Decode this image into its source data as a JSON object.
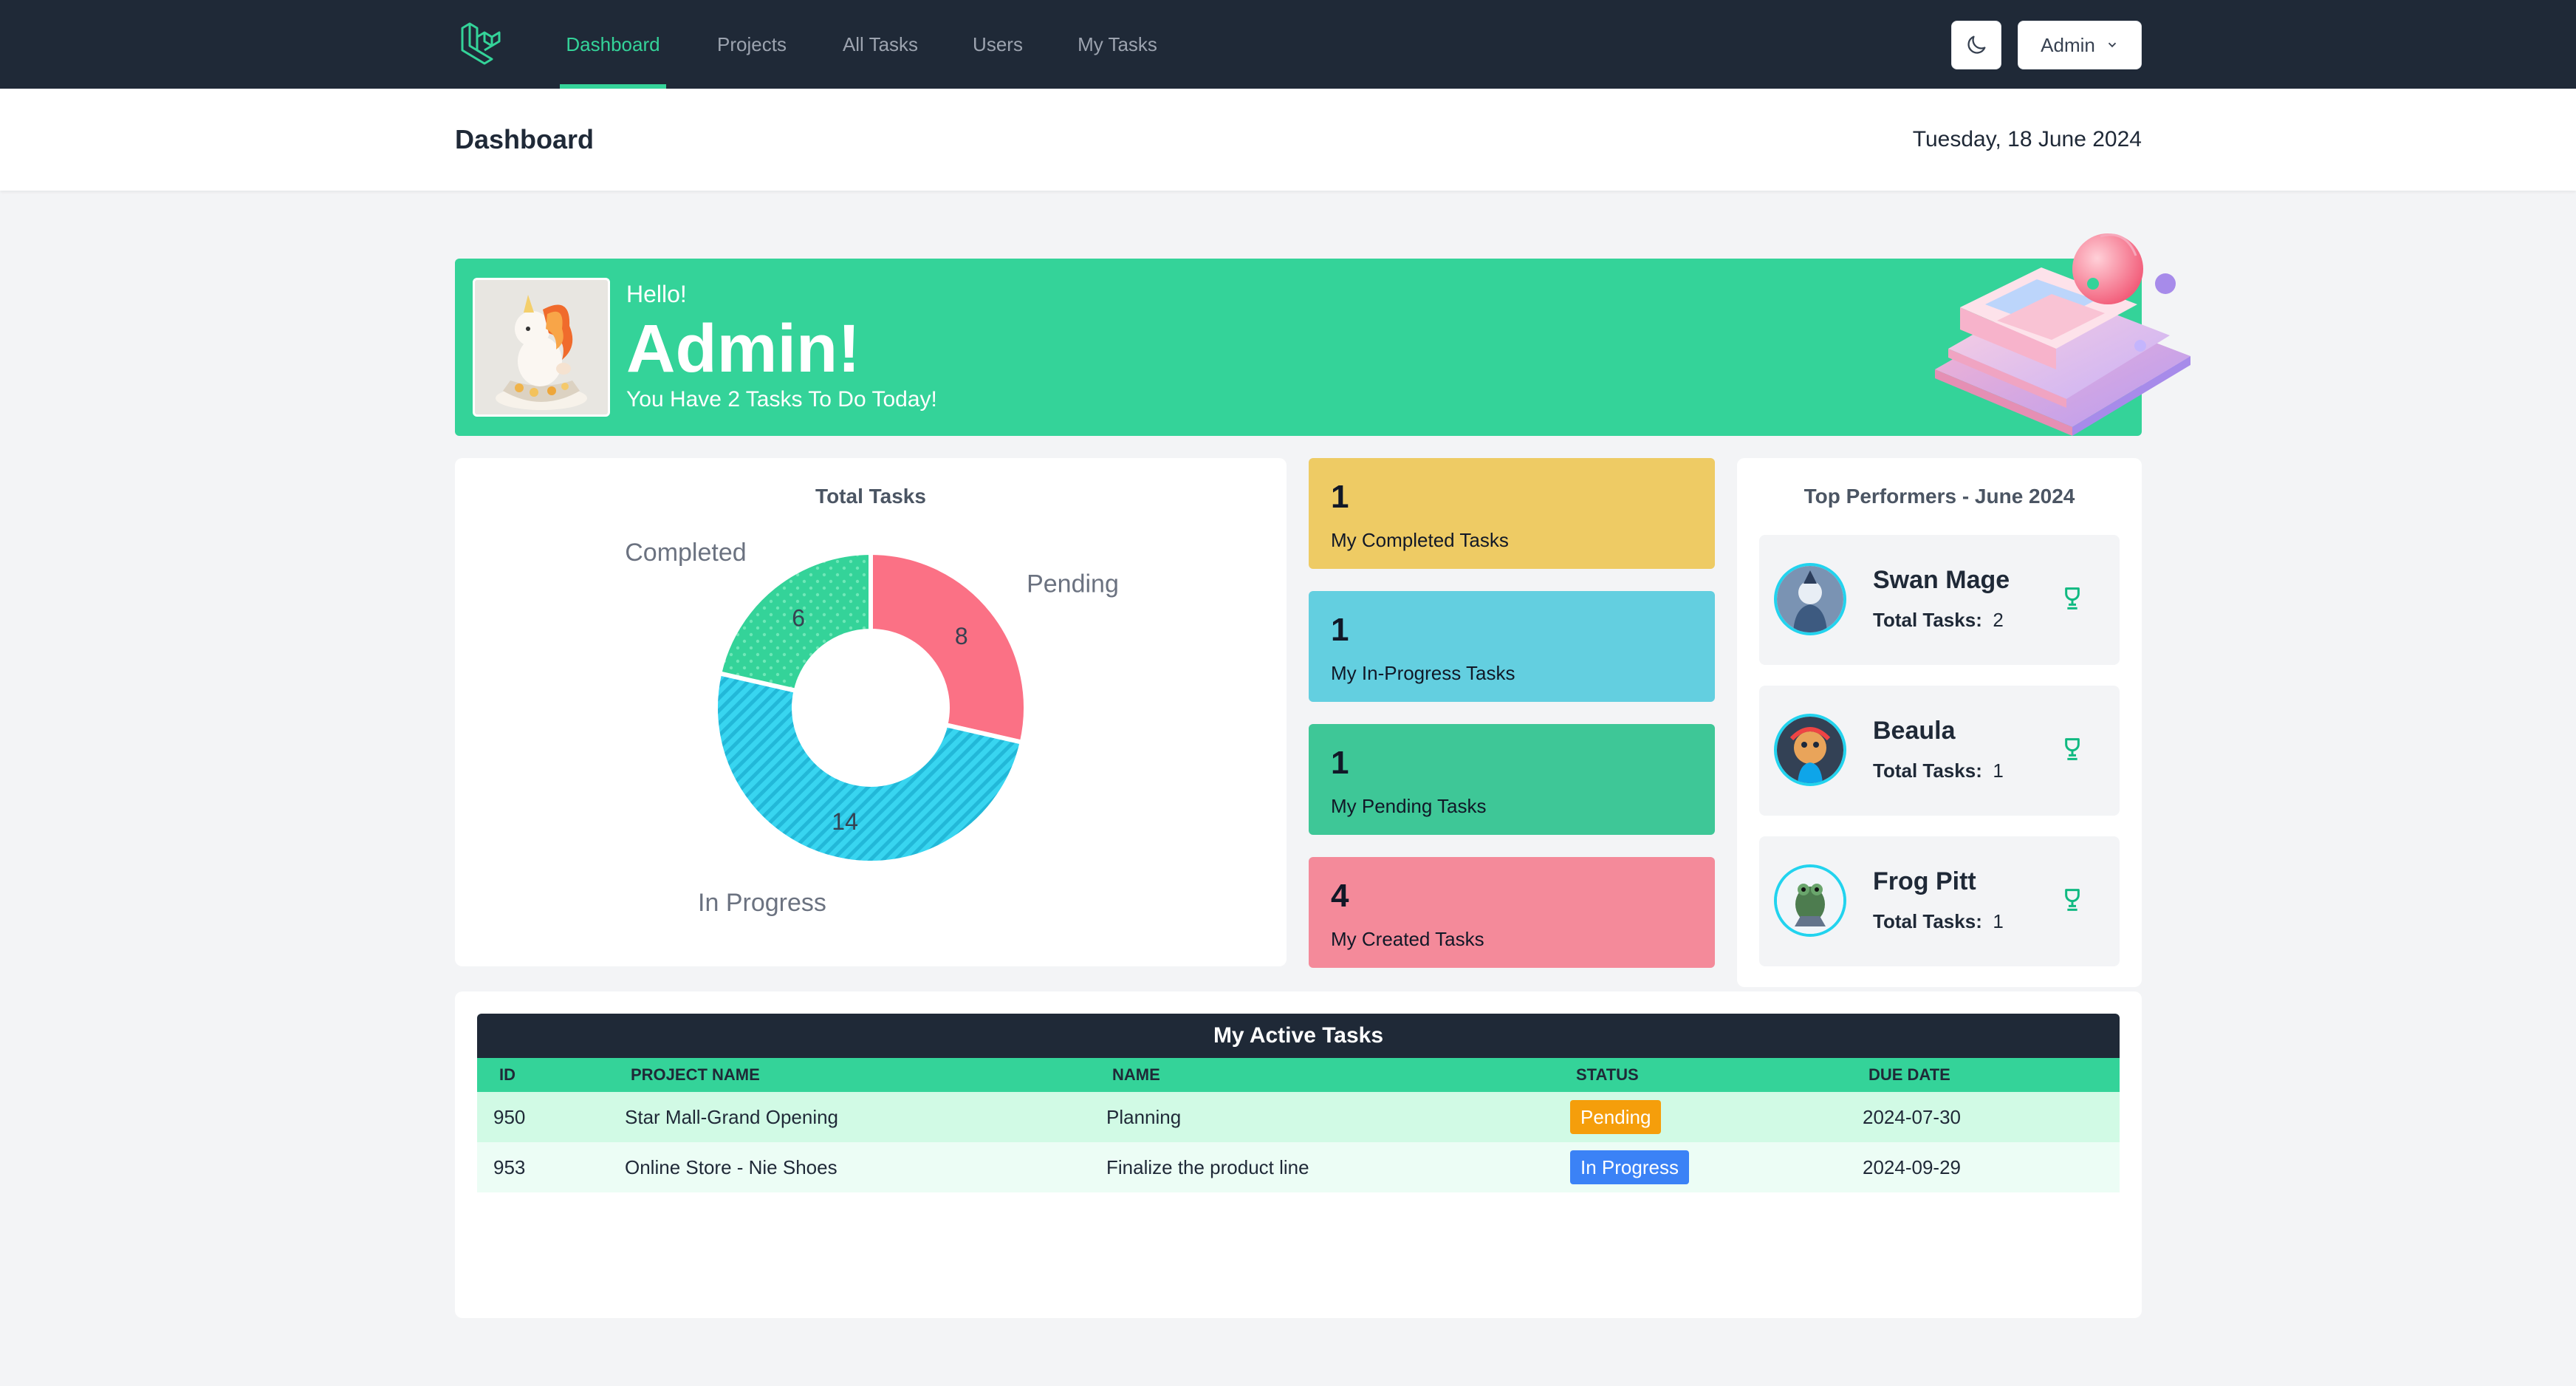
{
  "nav": {
    "items": [
      {
        "label": "Dashboard",
        "active": true
      },
      {
        "label": "Projects",
        "active": false
      },
      {
        "label": "All Tasks",
        "active": false
      },
      {
        "label": "Users",
        "active": false
      },
      {
        "label": "My Tasks",
        "active": false
      }
    ],
    "user_label": "Admin",
    "theme_icon": "moon-icon",
    "accent": "#34d399"
  },
  "header": {
    "title": "Dashboard",
    "date": "Tuesday, 18 June 2024"
  },
  "hero": {
    "hello": "Hello!",
    "name": "Admin!",
    "subtitle": "You Have 2 Tasks To Do Today!"
  },
  "chart_data": {
    "type": "pie",
    "title": "Total Tasks",
    "categories": [
      "Pending",
      "In Progress",
      "Completed"
    ],
    "values": [
      8,
      14,
      6
    ],
    "colors": [
      "#fb7185",
      "#38d5f0",
      "#34d399"
    ],
    "hole": true
  },
  "stats": [
    {
      "value": "1",
      "label": "My Completed Tasks",
      "color": "#eecb64"
    },
    {
      "value": "1",
      "label": "My In-Progress Tasks",
      "color": "#63cfe0"
    },
    {
      "value": "1",
      "label": "My Pending Tasks",
      "color": "#3ec797"
    },
    {
      "value": "4",
      "label": "My Created Tasks",
      "color": "#f48a9a"
    }
  ],
  "performers": {
    "title": "Top Performers - June 2024",
    "total_label": "Total Tasks:",
    "items": [
      {
        "name": "Swan Mage",
        "total": "2"
      },
      {
        "name": "Beaula",
        "total": "1"
      },
      {
        "name": "Frog Pitt",
        "total": "1"
      }
    ]
  },
  "tasks_table": {
    "title": "My Active Tasks",
    "columns": [
      "ID",
      "PROJECT NAME",
      "NAME",
      "STATUS",
      "DUE DATE"
    ],
    "rows": [
      {
        "id": "950",
        "project": "Star Mall-Grand Opening",
        "name": "Planning",
        "status": "Pending",
        "status_color": "#f59e0b",
        "due": "2024-07-30"
      },
      {
        "id": "953",
        "project": "Online Store - Nie Shoes",
        "name": "Finalize the product line",
        "status": "In Progress",
        "status_color": "#3b82f6",
        "due": "2024-09-29"
      }
    ]
  }
}
